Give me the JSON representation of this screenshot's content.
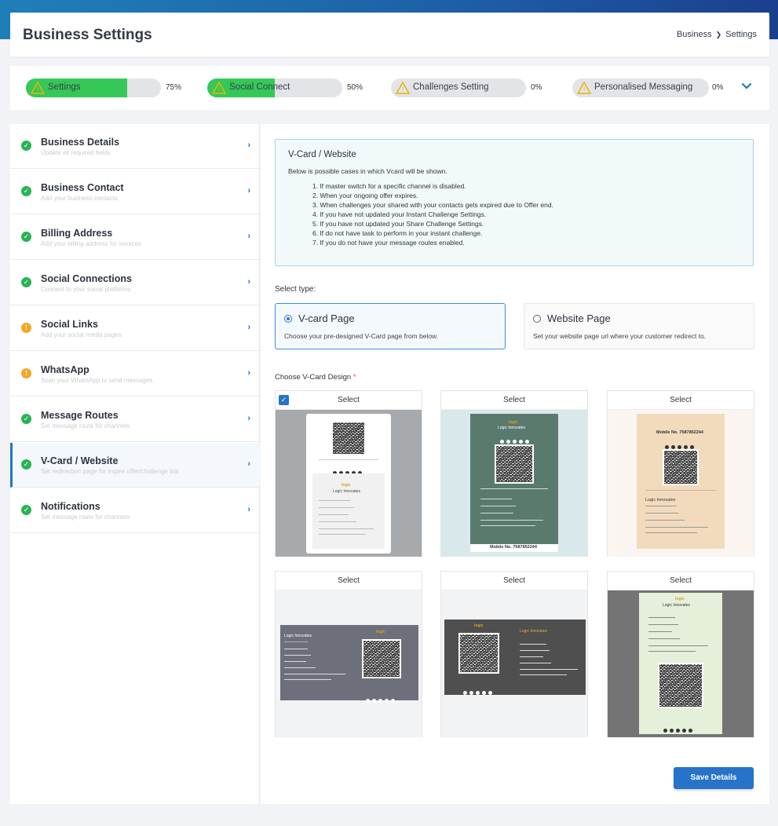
{
  "header": {
    "title": "Business Settings",
    "breadcrumb": {
      "home": "Business",
      "sep": "❯",
      "current": "Settings"
    }
  },
  "progress": [
    {
      "label": "Settings",
      "pct_text": "75%",
      "fraction": 0.75,
      "complete": true
    },
    {
      "label": "Social Connect",
      "pct_text": "50%",
      "fraction": 0.5,
      "complete": true
    },
    {
      "label": "Challenges Setting",
      "pct_text": "0%",
      "fraction": 0,
      "complete": false
    },
    {
      "label": "Personalised Messaging",
      "pct_text": "0%",
      "fraction": 0,
      "complete": false
    }
  ],
  "sidebar": {
    "items": [
      {
        "title": "Business Details",
        "subtitle": "Update all required fields",
        "status": "ok"
      },
      {
        "title": "Business Contact",
        "subtitle": "Add your business contacts",
        "status": "ok"
      },
      {
        "title": "Billing Address",
        "subtitle": "Add your billing address for invoices",
        "status": "ok"
      },
      {
        "title": "Social Connections",
        "subtitle": "Connect to your social platforms",
        "status": "ok"
      },
      {
        "title": "Social Links",
        "subtitle": "Add your social media pages",
        "status": "warn"
      },
      {
        "title": "WhatsApp",
        "subtitle": "Scan your WhatsApp to send messages.",
        "status": "warn"
      },
      {
        "title": "Message Routes",
        "subtitle": "Set message route for channels",
        "status": "ok"
      },
      {
        "title": "V-Card / Website",
        "subtitle": "Set redirection page for expire offer/challenge link",
        "status": "ok",
        "active": true
      },
      {
        "title": "Notifications",
        "subtitle": "Set message route for channels",
        "status": "ok"
      }
    ]
  },
  "info": {
    "title": "V-Card / Website",
    "intro": "Below is possible cases in which Vcard will be shown.",
    "cases": [
      "1. If master switch for a specific channel is disabled.",
      "2. When your ongoing offer expires.",
      "3. When challenges your shared with your contacts gets expired due to Offer end.",
      "4. If you have not updated your Instant Challenge Settings.",
      "5. If you have not updated your Share Challenge Settings.",
      "6. If do not have task to perform in your instant challenge.",
      "7. If you do not have your message routes enabled."
    ]
  },
  "select_type": {
    "label": "Select type:",
    "options": [
      {
        "title": "V-card Page",
        "desc": "Choose your pre-designed V-Card page from below.",
        "selected": true
      },
      {
        "title": "Website Page",
        "desc": "Set your website page url where your customer redirect to.",
        "selected": false
      }
    ]
  },
  "design": {
    "label": "Choose V-Card Design",
    "required_mark": "*",
    "select_label": "Select",
    "check_mark": "✓",
    "cards": [
      {
        "variant": "grey-white",
        "checked": true,
        "bg": "#a7aaad",
        "name": "Logic Innovates",
        "logo": "logic"
      },
      {
        "variant": "green-dark",
        "checked": false,
        "bg": "#d9e8ea",
        "name": "Logic Innovates",
        "mobile": "Mobile No. 7587852244",
        "logo": "logic"
      },
      {
        "variant": "peach",
        "checked": false,
        "bg": "#fbf5f1",
        "name": "Logic Innovates",
        "mobile": "Mobile No. 7587852244"
      },
      {
        "variant": "landscape-grey",
        "checked": false,
        "bg": "#f2f3f4",
        "name": "Logic Innovates",
        "logo": "logic"
      },
      {
        "variant": "landscape-dark",
        "checked": false,
        "bg": "#f2f3f4",
        "name": "Logic Innovates",
        "logo": "logic"
      },
      {
        "variant": "mint",
        "checked": false,
        "bg": "#747474",
        "name": "Logic Innovates",
        "logo": "logic"
      }
    ]
  },
  "save_label": "Save Details",
  "colors": {
    "accent": "#2673c9",
    "success": "#27b454",
    "warning": "#f5a623",
    "progress_fill": "#35c858"
  }
}
